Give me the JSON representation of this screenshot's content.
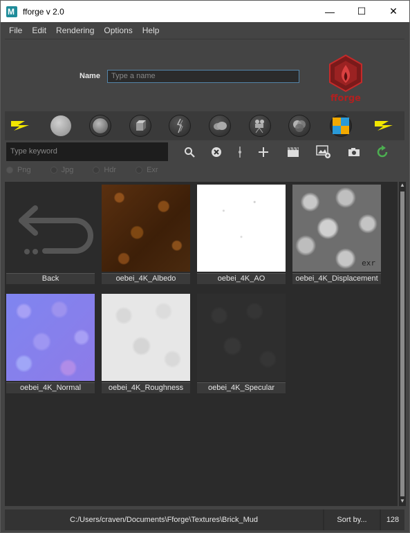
{
  "window": {
    "title": "fforge v 2.0",
    "minimize": "—",
    "maximize": "☐",
    "close": "✕"
  },
  "menu": [
    "File",
    "Edit",
    "Rendering",
    "Options",
    "Help"
  ],
  "header": {
    "name_label": "Name",
    "name_placeholder": "Type a name",
    "logo_text": "fforge"
  },
  "toolbar_icons": [
    "lightning-left-icon",
    "sphere-icon",
    "shader-ball-icon",
    "cube-icon",
    "hair-icon",
    "cloud-icon",
    "projector-icon",
    "color-mix-icon",
    "color-checker-icon",
    "lightning-right-icon"
  ],
  "search": {
    "placeholder": "Type keyword"
  },
  "actions": [
    "search-icon",
    "clear-icon",
    "separator-icon",
    "add-icon",
    "clapper-icon",
    "image-add-icon",
    "camera-icon",
    "refresh-icon"
  ],
  "formats": [
    {
      "label": "Png",
      "selected": true
    },
    {
      "label": "Jpg",
      "selected": false
    },
    {
      "label": "Hdr",
      "selected": false
    },
    {
      "label": "Exr",
      "selected": false
    }
  ],
  "items": [
    {
      "label": "Back"
    },
    {
      "label": "oebei_4K_Albedo"
    },
    {
      "label": "oebei_4K_AO"
    },
    {
      "label": "oebei_4K_Displacement",
      "badge": "exr"
    },
    {
      "label": "oebei_4K_Normal"
    },
    {
      "label": "oebei_4K_Roughness"
    },
    {
      "label": "oebei_4K_Specular"
    }
  ],
  "status": {
    "path": "C:/Users/craven/Documents\\Fforge\\Textures\\Brick_Mud",
    "sort": "Sort by...",
    "size": "128"
  },
  "colors": {
    "accent_yellow": "#f2e600",
    "logo_red": "#b02020",
    "refresh_green": "#4caf50",
    "input_border": "#5385a9"
  }
}
